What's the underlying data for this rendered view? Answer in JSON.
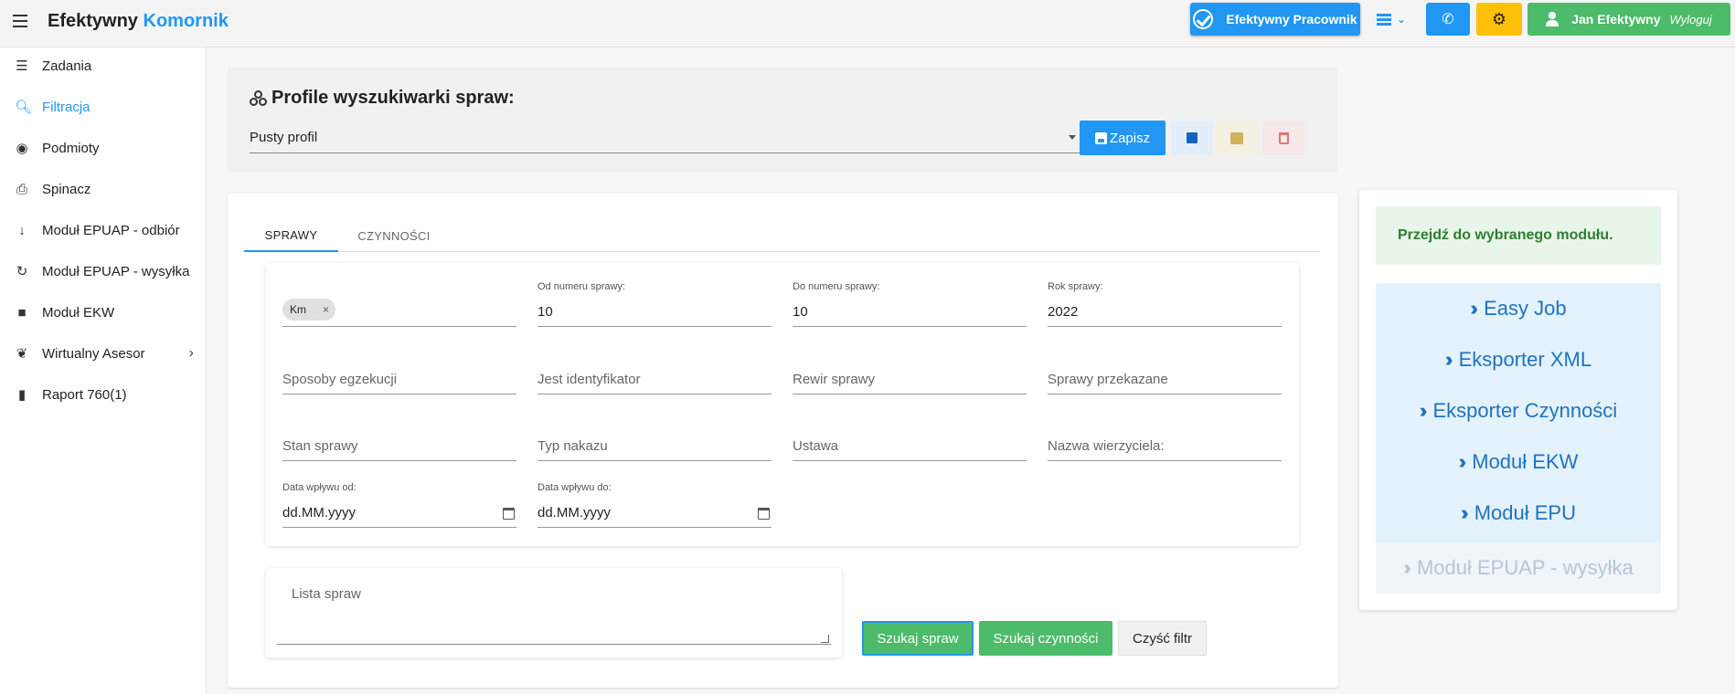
{
  "header": {
    "brand_main": "Efektywny",
    "brand_accent": "Komornik",
    "pracownik_label": "Efektywny Pracownik",
    "user_name": "Jan Efektywny",
    "logout_label": "Wyloguj",
    "icons": [
      "menu-icon",
      "check-circle-icon",
      "list-icon",
      "chevron-down-icon",
      "phone-icon",
      "gear-icon",
      "user-icon"
    ]
  },
  "sidebar": {
    "items": [
      {
        "label": "Zadania",
        "icon": "tasks-icon"
      },
      {
        "label": "Filtracja",
        "icon": "search-icon"
      },
      {
        "label": "Podmioty",
        "icon": "globe-icon"
      },
      {
        "label": "Spinacz",
        "icon": "paperclip-icon"
      },
      {
        "label": "Moduł EPUAP - odbiór",
        "icon": "arrow-down-icon"
      },
      {
        "label": "Moduł EPUAP - wysyłka",
        "icon": "redo-icon"
      },
      {
        "label": "Moduł EKW",
        "icon": "book-icon"
      },
      {
        "label": "Wirtualny Asesor",
        "icon": "handshake-icon"
      },
      {
        "label": "Raport 760(1)",
        "icon": "file-icon"
      }
    ],
    "active_index": 1
  },
  "profiles": {
    "title": "Profile wyszukiwarki spraw:",
    "selected": "Pusty profil",
    "save_label": "Zapisz"
  },
  "tabs": [
    {
      "label": "SPRAWY"
    },
    {
      "label": "CZYNNOŚCI"
    }
  ],
  "filters": {
    "chip": "Km",
    "chip_remove": "×",
    "od_numeru": {
      "label": "Od numeru sprawy:",
      "value": "10"
    },
    "do_numeru": {
      "label": "Do numeru sprawy:",
      "value": "10"
    },
    "rok": {
      "label": "Rok sprawy:",
      "value": "2022"
    },
    "sposoby": "Sposoby egzekucji",
    "identyfikator": "Jest identyfikator",
    "rewir": "Rewir sprawy",
    "przekazane": "Sprawy przekazane",
    "stan": "Stan sprawy",
    "typ": "Typ nakazu",
    "ustawa": "Ustawa",
    "wierzyciel": "Nazwa wierzyciela:",
    "data_od": {
      "label": "Data wpływu od:",
      "value": "dd.MM.yyyy"
    },
    "data_do": {
      "label": "Data wpływu do:",
      "value": "dd.MM.yyyy"
    },
    "lista_placeholder": "Lista spraw"
  },
  "actions": {
    "szukaj_spraw": "Szukaj spraw",
    "szukaj_czynnosci": "Szukaj czynności",
    "wyczysc": "Czyść filtr"
  },
  "modules": {
    "heading": "Przejdź do wybranego modułu.",
    "items": [
      {
        "label": "Easy Job",
        "enabled": true
      },
      {
        "label": "Eksporter XML",
        "enabled": true
      },
      {
        "label": "Eksporter Czynności",
        "enabled": true
      },
      {
        "label": "Moduł EKW",
        "enabled": true
      },
      {
        "label": "Moduł EPU",
        "enabled": true
      },
      {
        "label": "Moduł EPUAP - wysyłka",
        "enabled": false
      }
    ]
  },
  "colors": {
    "primary": "#2196f3",
    "success": "#4cbb6a",
    "warning": "#ffc107"
  }
}
